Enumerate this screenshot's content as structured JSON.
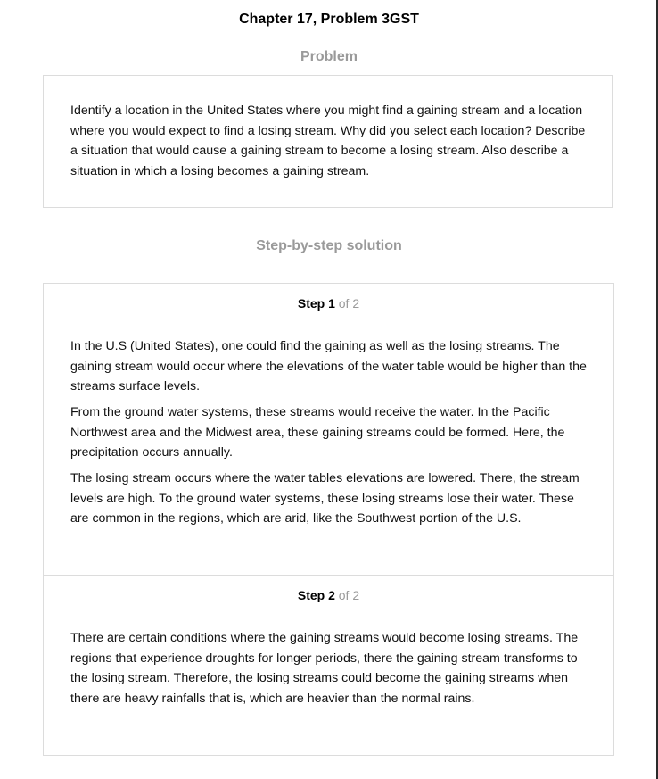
{
  "page": {
    "title": "Chapter 17, Problem 3GST"
  },
  "problem": {
    "heading": "Problem",
    "text": "Identify a location in the United States where you might find a gaining stream and a location where you would expect to find a losing stream. Why did you select each location? Describe a situation that would cause a gaining stream to become a losing stream. Also describe a situation in which a losing becomes a gaining stream."
  },
  "solution": {
    "heading": "Step-by-step solution",
    "steps": [
      {
        "label": "Step 1",
        "of": "of 2",
        "paragraphs": [
          "In the U.S (United States), one could find the gaining as well as the losing streams. The gaining stream would occur where the elevations of the water table would be higher than the streams surface levels.",
          "From the ground water systems, these streams would receive the water. In the Pacific Northwest area and the Midwest area, these gaining streams could be formed. Here, the precipitation occurs annually.",
          "The losing stream occurs where the water tables elevations are lowered. There, the stream levels are high. To the ground water systems, these losing streams lose their water. These are common in the regions, which are arid, like the Southwest portion of the U.S."
        ]
      },
      {
        "label": "Step 2",
        "of": "of 2",
        "paragraphs": [
          "There are certain conditions where the gaining streams would become losing streams. The regions that experience droughts for longer periods, there the gaining stream transforms to the losing stream. Therefore, the losing streams could become the gaining streams when there are heavy rainfalls that is, which are heavier than the normal rains."
        ]
      }
    ]
  },
  "colors": {
    "heading_gray": "#9a9a9a",
    "border": "#dcdcdc",
    "text": "#111111"
  }
}
